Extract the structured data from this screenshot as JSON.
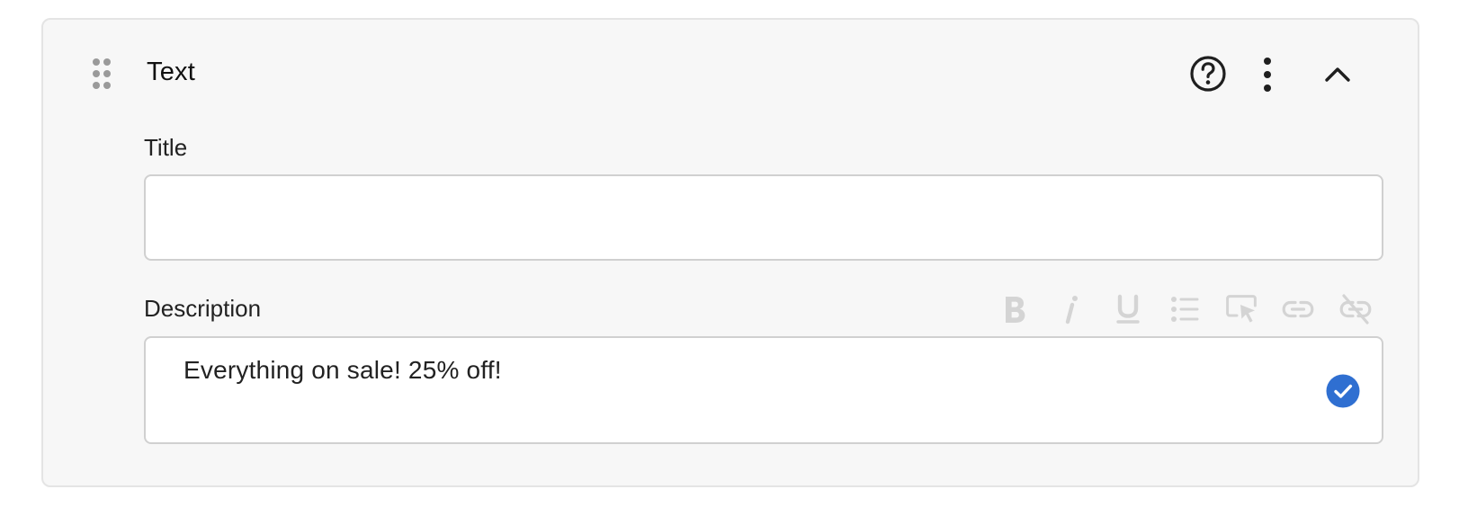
{
  "block": {
    "title": "Text",
    "icons": {
      "drag": "drag-handle-icon",
      "help": "help-circle-icon",
      "more": "more-vertical-icon",
      "collapse": "chevron-up-icon"
    }
  },
  "fields": {
    "title": {
      "label": "Title",
      "value": "",
      "placeholder": ""
    },
    "description": {
      "label": "Description",
      "value": "Everything on sale! 25% off!",
      "status_icon": "check-circle-icon"
    }
  },
  "toolbar": {
    "items": [
      {
        "name": "bold",
        "icon": "bold-icon"
      },
      {
        "name": "italic",
        "icon": "italic-icon"
      },
      {
        "name": "underline",
        "icon": "underline-icon"
      },
      {
        "name": "bulleted-list",
        "icon": "list-icon"
      },
      {
        "name": "select",
        "icon": "cursor-select-icon"
      },
      {
        "name": "link",
        "icon": "link-icon"
      },
      {
        "name": "unlink",
        "icon": "unlink-icon"
      }
    ],
    "state": "disabled"
  },
  "colors": {
    "card_background": "#f7f7f7",
    "card_border": "#e4e4e4",
    "input_border": "#d0d0d0",
    "toolbar_disabled": "#d4d4d4",
    "accent_blue": "#2f6fd1",
    "icon_dark": "#1f1f1f"
  }
}
